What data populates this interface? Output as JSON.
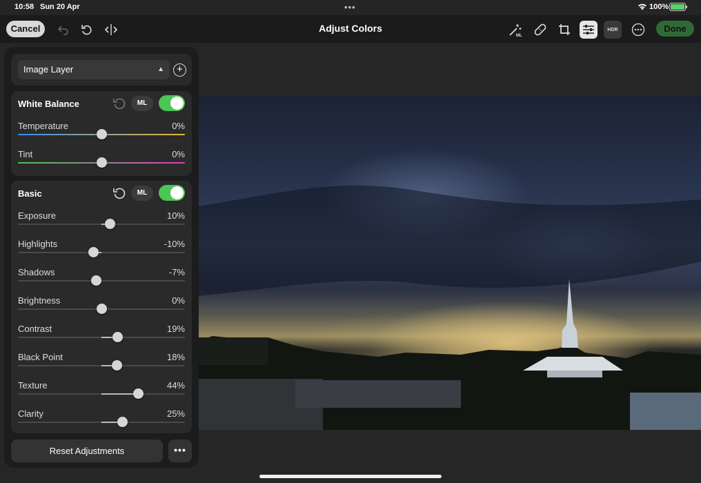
{
  "status": {
    "time": "10:58",
    "date": "Sun 20 Apr",
    "battery": "100%"
  },
  "toolbar": {
    "cancel": "Cancel",
    "title": "Adjust Colors",
    "hdr": "HDR",
    "done": "Done"
  },
  "layer": {
    "name": "Image Layer"
  },
  "white_balance": {
    "title": "White Balance",
    "ml": "ML",
    "rows": [
      {
        "label": "Temperature",
        "value": "0%",
        "level": 0
      },
      {
        "label": "Tint",
        "value": "0%",
        "level": 0
      }
    ]
  },
  "basic": {
    "title": "Basic",
    "ml": "ML",
    "rows": [
      {
        "label": "Exposure",
        "value": "10%",
        "level": 0.1
      },
      {
        "label": "Highlights",
        "value": "-10%",
        "level": -0.1
      },
      {
        "label": "Shadows",
        "value": "-7%",
        "level": -0.07
      },
      {
        "label": "Brightness",
        "value": "0%",
        "level": 0
      },
      {
        "label": "Contrast",
        "value": "19%",
        "level": 0.19
      },
      {
        "label": "Black Point",
        "value": "18%",
        "level": 0.18
      },
      {
        "label": "Texture",
        "value": "44%",
        "level": 0.44
      },
      {
        "label": "Clarity",
        "value": "25%",
        "level": 0.25
      }
    ]
  },
  "footer": {
    "reset": "Reset Adjustments"
  },
  "colors": {
    "accent_green": "#4cc655",
    "done_bg": "#2f6a35"
  }
}
